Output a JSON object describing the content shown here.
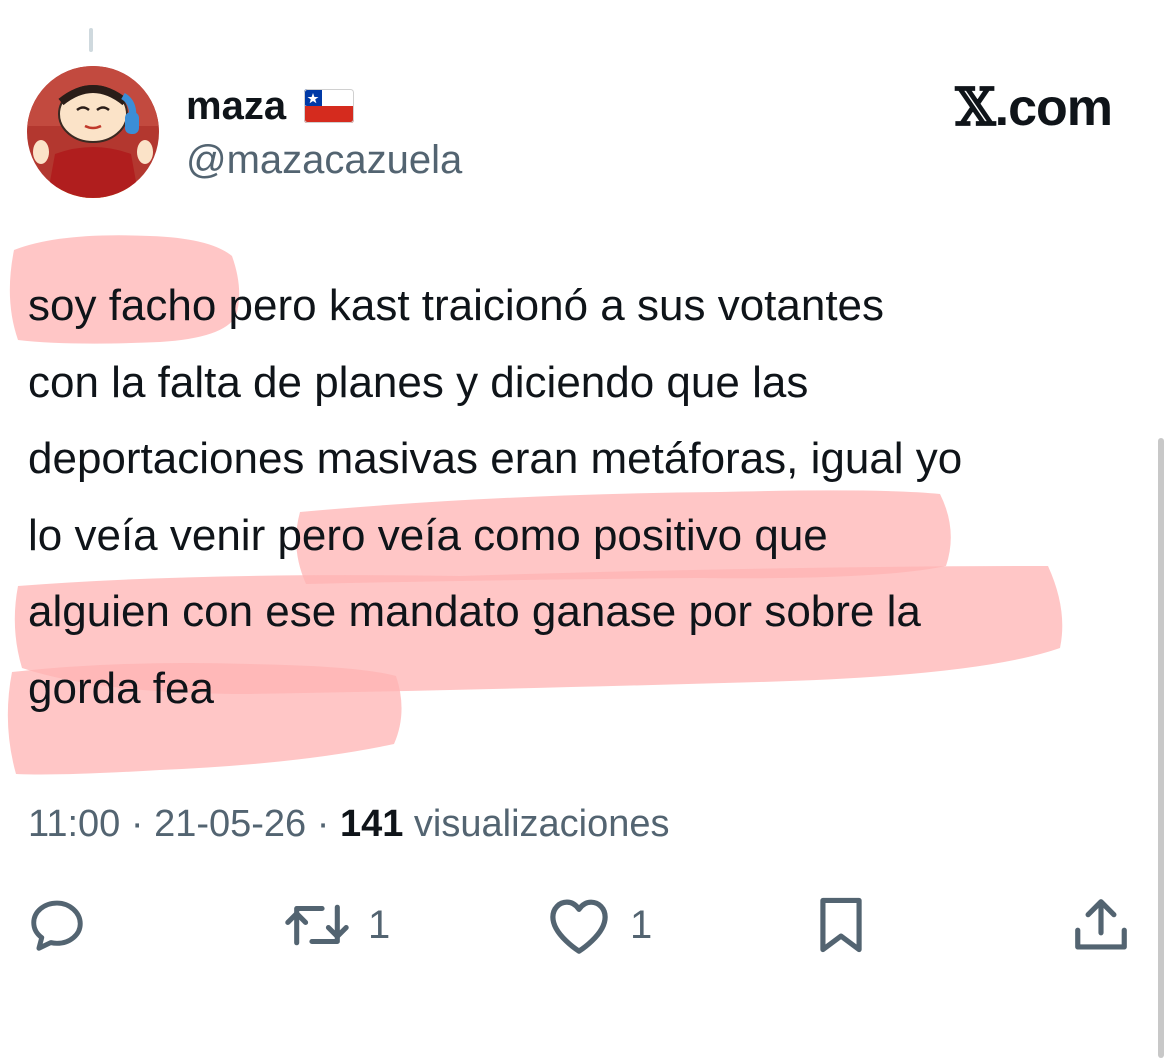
{
  "author": {
    "display_name": "maza",
    "handle": "@mazacazuela",
    "avatar_icon": "cartoon-avatar-with-headphones",
    "flag_icon": "chile-flag-icon"
  },
  "brand": {
    "x_glyph": "𝕏",
    "suffix": ".com"
  },
  "tweet": {
    "text": "soy facho pero kast traicionó a sus votantes\ncon la falta de planes y diciendo que las\ndeportaciones masivas eran metáforas, igual yo\nlo veía venir pero veía como positivo que\nalguien con ese mandato ganase por sobre la\ngorda fea"
  },
  "meta": {
    "time": "11:00",
    "separator_1": " · ",
    "date": "21-05-26",
    "separator_2": " · ",
    "views_count": "141",
    "views_label": " visualizaciones"
  },
  "actions": {
    "reply_icon": "reply-icon",
    "retweet_count": "1",
    "like_count": "1",
    "bookmark_icon": "bookmark-icon",
    "share_icon": "share-icon"
  },
  "colors": {
    "text": "#0f1419",
    "secondary": "#536471",
    "highlight": "#ffb3b3"
  }
}
